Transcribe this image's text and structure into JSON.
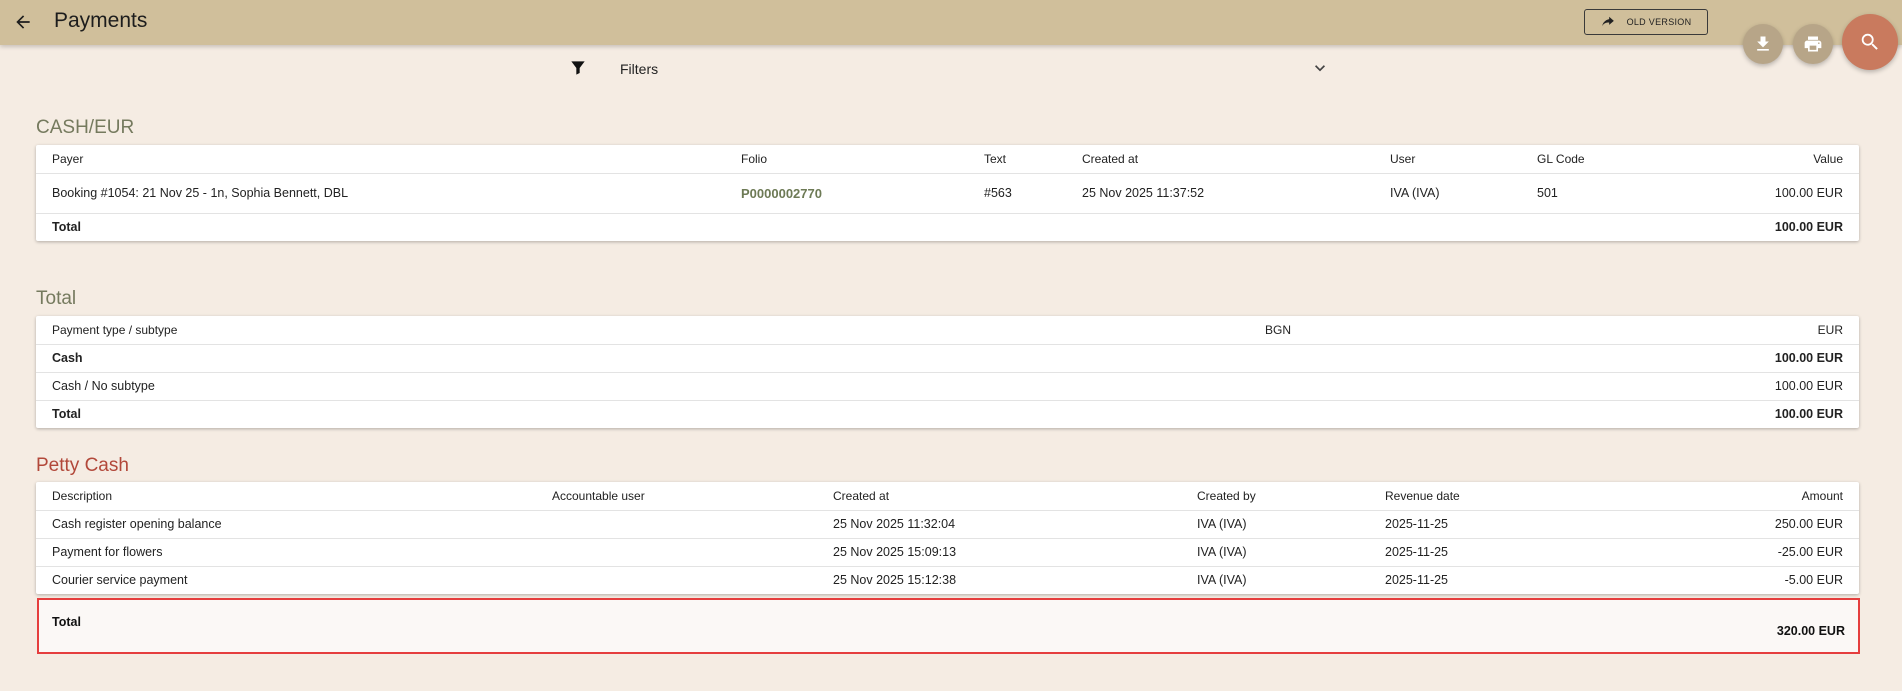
{
  "header": {
    "title": "Payments",
    "old_version_label": "OLD VERSION"
  },
  "filters": {
    "label": "Filters"
  },
  "cash_eur": {
    "title": "CASH/EUR",
    "columns": [
      "Payer",
      "Folio",
      "Text",
      "Created at",
      "User",
      "GL Code",
      "Value"
    ],
    "rows": [
      [
        "Booking #1054: 21 Nov 25 - 1n, Sophia Bennett, DBL",
        "P0000002770",
        "#563",
        "25 Nov 2025 11:37:52",
        "IVA (IVA)",
        "501",
        "100.00 EUR"
      ]
    ],
    "total_label": "Total",
    "total_value": "100.00 EUR"
  },
  "totals": {
    "title": "Total",
    "columns": [
      "Payment type / subtype",
      "BGN",
      "EUR"
    ],
    "rows": [
      [
        "Cash",
        "",
        "100.00 EUR"
      ],
      [
        "Cash / No subtype",
        "",
        "100.00 EUR"
      ]
    ],
    "total_label": "Total",
    "total_value": "100.00 EUR"
  },
  "petty_cash": {
    "title": "Petty Cash",
    "columns": [
      "Description",
      "Accountable user",
      "Created at",
      "Created by",
      "Revenue date",
      "Amount"
    ],
    "rows": [
      [
        "Cash register opening balance",
        "",
        "25 Nov 2025 11:32:04",
        "IVA (IVA)",
        "2025-11-25",
        "250.00 EUR"
      ],
      [
        "Payment for flowers",
        "",
        "25 Nov 2025 15:09:13",
        "IVA (IVA)",
        "2025-11-25",
        "-25.00 EUR"
      ],
      [
        "Courier service payment",
        "",
        "25 Nov 2025 15:12:38",
        "IVA (IVA)",
        "2025-11-25",
        "-5.00 EUR"
      ]
    ],
    "total_label": "Total",
    "total_value": "320.00 EUR"
  },
  "colors": {
    "topbar": "#d0bf9b",
    "background": "#f5ece3",
    "olive_title": "#757a5e",
    "red_title": "#b2483a",
    "search_fab": "#c97a5e",
    "highlight_border": "#e53e3e"
  },
  "icons": [
    "arrow-left-icon",
    "share-arrow-icon",
    "download-icon",
    "print-icon",
    "search-icon",
    "filter-icon",
    "chevron-down-icon"
  ]
}
